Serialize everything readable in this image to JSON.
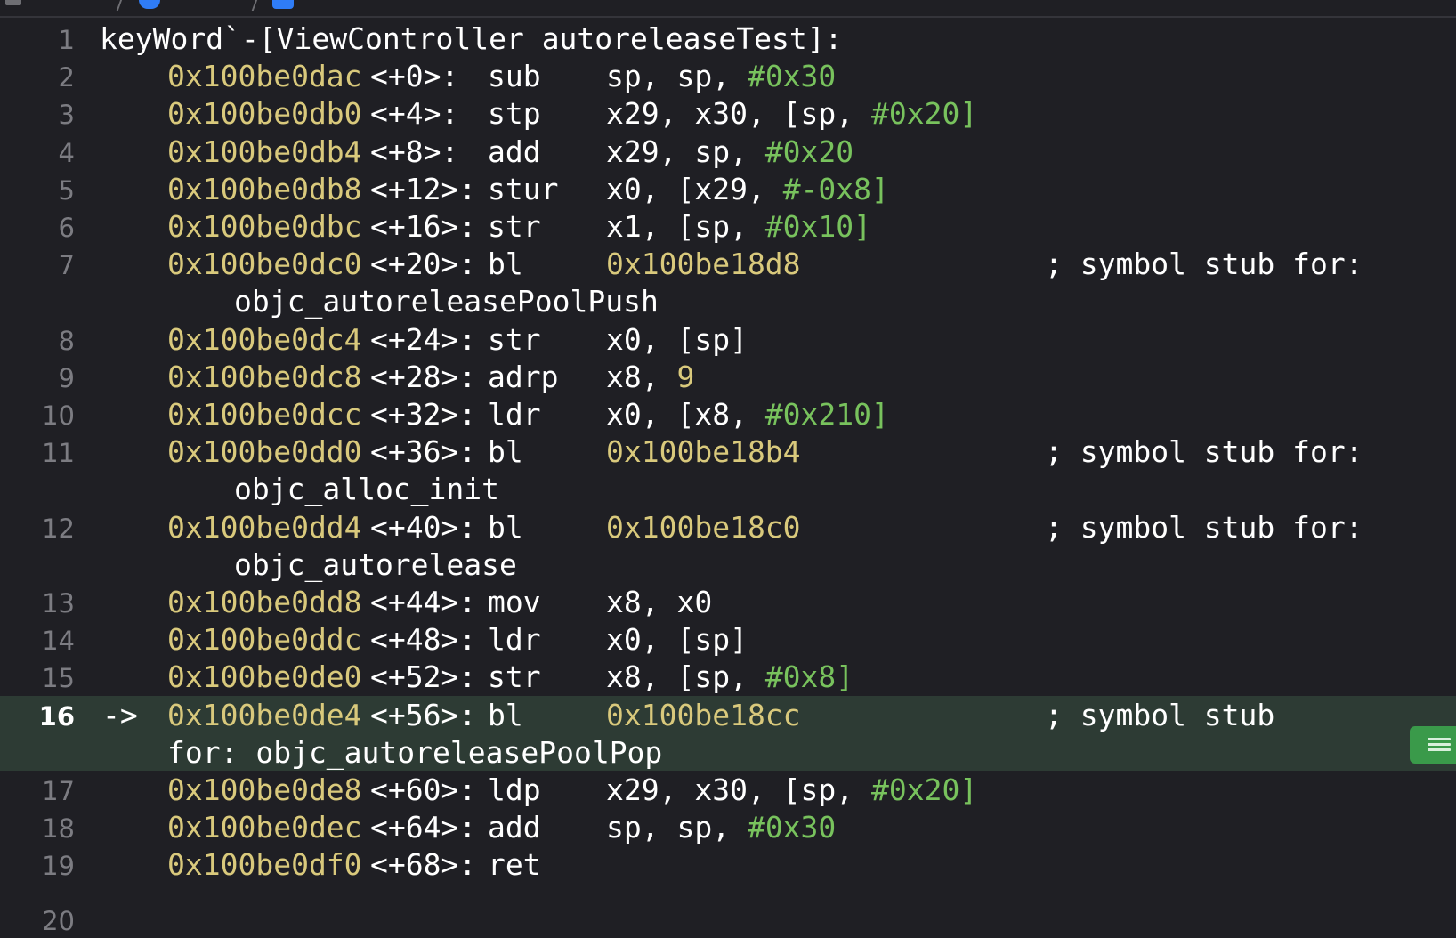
{
  "editor": {
    "title_line": {
      "number": "1",
      "text": "keyWord`-[ViewController autoreleaseTest]:"
    },
    "next_line_number": "20",
    "current_line_marker": "->",
    "lines": [
      {
        "number": "2",
        "addr": "0x100be0dac",
        "offset": "<+0>:",
        "op": "sub",
        "args": [
          {
            "t": "sp, sp, ",
            "c": "p"
          },
          {
            "t": "#0x30",
            "c": "n"
          }
        ]
      },
      {
        "number": "3",
        "addr": "0x100be0db0",
        "offset": "<+4>:",
        "op": "stp",
        "args": [
          {
            "t": "x29, x30, [sp, ",
            "c": "p"
          },
          {
            "t": "#0x20]",
            "c": "n"
          }
        ]
      },
      {
        "number": "4",
        "addr": "0x100be0db4",
        "offset": "<+8>:",
        "op": "add",
        "args": [
          {
            "t": "x29, sp, ",
            "c": "p"
          },
          {
            "t": "#0x20",
            "c": "n"
          }
        ]
      },
      {
        "number": "5",
        "addr": "0x100be0db8",
        "offset": "<+12>:",
        "op": "stur",
        "args": [
          {
            "t": "x0, [x29, ",
            "c": "p"
          },
          {
            "t": "#-0x8]",
            "c": "n"
          }
        ]
      },
      {
        "number": "6",
        "addr": "0x100be0dbc",
        "offset": "<+16>:",
        "op": "str",
        "args": [
          {
            "t": "x1, [sp, ",
            "c": "p"
          },
          {
            "t": "#0x10]",
            "c": "n"
          }
        ]
      },
      {
        "number": "7",
        "addr": "0x100be0dc0",
        "offset": "<+20>:",
        "op": "bl",
        "args": [
          {
            "t": "0x100be18d8",
            "c": "a"
          }
        ],
        "comment": "; symbol stub for:",
        "wrap": "objc_autoreleasePoolPush"
      },
      {
        "number": "8",
        "addr": "0x100be0dc4",
        "offset": "<+24>:",
        "op": "str",
        "args": [
          {
            "t": "x0, [sp]",
            "c": "p"
          }
        ]
      },
      {
        "number": "9",
        "addr": "0x100be0dc8",
        "offset": "<+28>:",
        "op": "adrp",
        "args": [
          {
            "t": "x8, ",
            "c": "p"
          },
          {
            "t": "9",
            "c": "a"
          }
        ]
      },
      {
        "number": "10",
        "addr": "0x100be0dcc",
        "offset": "<+32>:",
        "op": "ldr",
        "args": [
          {
            "t": "x0, [x8, ",
            "c": "p"
          },
          {
            "t": "#0x210]",
            "c": "n"
          }
        ]
      },
      {
        "number": "11",
        "addr": "0x100be0dd0",
        "offset": "<+36>:",
        "op": "bl",
        "args": [
          {
            "t": "0x100be18b4",
            "c": "a"
          }
        ],
        "comment": "; symbol stub for:",
        "wrap": "objc_alloc_init"
      },
      {
        "number": "12",
        "addr": "0x100be0dd4",
        "offset": "<+40>:",
        "op": "bl",
        "args": [
          {
            "t": "0x100be18c0",
            "c": "a"
          }
        ],
        "comment": "; symbol stub for:",
        "wrap": "objc_autorelease"
      },
      {
        "number": "13",
        "addr": "0x100be0dd8",
        "offset": "<+44>:",
        "op": "mov",
        "args": [
          {
            "t": "x8, x0",
            "c": "p"
          }
        ]
      },
      {
        "number": "14",
        "addr": "0x100be0ddc",
        "offset": "<+48>:",
        "op": "ldr",
        "args": [
          {
            "t": "x0, [sp]",
            "c": "p"
          }
        ]
      },
      {
        "number": "15",
        "addr": "0x100be0de0",
        "offset": "<+52>:",
        "op": "str",
        "args": [
          {
            "t": "x8, [sp, ",
            "c": "p"
          },
          {
            "t": "#0x8]",
            "c": "n"
          }
        ]
      },
      {
        "number": "16",
        "addr": "0x100be0de4",
        "offset": "<+56>:",
        "op": "bl",
        "args": [
          {
            "t": "0x100be18cc",
            "c": "a"
          }
        ],
        "comment": "; symbol stub",
        "wrap": "for: objc_autoreleasePoolPop",
        "current": true
      },
      {
        "number": "17",
        "addr": "0x100be0de8",
        "offset": "<+60>:",
        "op": "ldp",
        "args": [
          {
            "t": "x29, x30, [sp, ",
            "c": "p"
          },
          {
            "t": "#0x20]",
            "c": "n"
          }
        ]
      },
      {
        "number": "18",
        "addr": "0x100be0dec",
        "offset": "<+64>:",
        "op": "add",
        "args": [
          {
            "t": "sp, sp, ",
            "c": "p"
          },
          {
            "t": "#0x30",
            "c": "n"
          }
        ]
      },
      {
        "number": "19",
        "addr": "0x100be0df0",
        "offset": "<+68>:",
        "op": "ret",
        "args": []
      }
    ]
  },
  "colors": {
    "background": "#1f1f24",
    "address": "#d9c97c",
    "immediate": "#78c25d",
    "line_number": "#7c7c82",
    "current_line_bg": "#2d3b34",
    "badge": "#3a9a4a"
  },
  "icons": {
    "breakpoint_badge": "lines-menu-icon"
  }
}
